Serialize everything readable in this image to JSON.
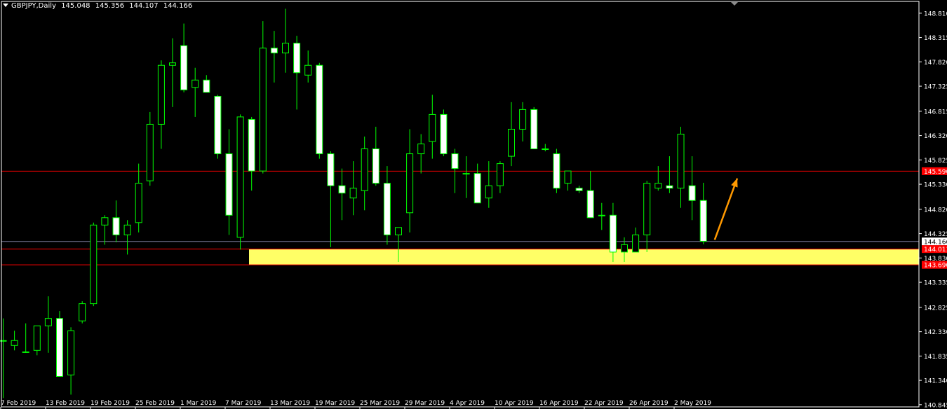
{
  "header": {
    "symbol": "GBPJPY,Daily",
    "open": "145.048",
    "high": "145.356",
    "low": "144.107",
    "close": "144.166"
  },
  "colors": {
    "background": "#000000",
    "frame": "#ffffff",
    "candle_bull_body": "#000000",
    "candle_bear_body": "#ffffff",
    "wick": "#00ff00",
    "hline": "#ff0000",
    "zone_fill": "#ffff66",
    "current_price_line": "#7f7f9f",
    "arrow": "#ff9900"
  },
  "chart_data": {
    "type": "candlestick",
    "y_ticks": [
      "148.810",
      "148.315",
      "147.820",
      "147.325",
      "146.815",
      "146.320",
      "145.825",
      "145.330",
      "144.820",
      "144.325",
      "143.830",
      "143.335",
      "142.825",
      "142.330",
      "141.835",
      "141.340",
      "140.845"
    ],
    "x_ticks": [
      "7 Feb 2019",
      "13 Feb 2019",
      "19 Feb 2019",
      "25 Feb 2019",
      "1 Mar 2019",
      "7 Mar 2019",
      "13 Mar 2019",
      "19 Mar 2019",
      "25 Mar 2019",
      "29 Mar 2019",
      "4 Apr 2019",
      "10 Apr 2019",
      "16 Apr 2019",
      "22 Apr 2019",
      "26 Apr 2019",
      "2 May 2019"
    ],
    "ylim": [
      140.8,
      149.05
    ],
    "candles": [
      {
        "o": 142.15,
        "h": 142.6,
        "l": 140.98,
        "c": 142.15
      },
      {
        "o": 142.05,
        "h": 142.35,
        "l": 141.95,
        "c": 142.15
      },
      {
        "o": 141.92,
        "h": 142.5,
        "l": 141.9,
        "c": 141.92
      },
      {
        "o": 141.95,
        "h": 142.4,
        "l": 141.85,
        "c": 142.45
      },
      {
        "o": 142.45,
        "h": 143.05,
        "l": 141.9,
        "c": 142.6
      },
      {
        "o": 142.6,
        "h": 142.75,
        "l": 141.42,
        "c": 141.42
      },
      {
        "o": 141.45,
        "h": 142.42,
        "l": 141.05,
        "c": 142.35
      },
      {
        "o": 142.55,
        "h": 142.95,
        "l": 142.5,
        "c": 142.9
      },
      {
        "o": 142.9,
        "h": 144.55,
        "l": 142.85,
        "c": 144.5
      },
      {
        "o": 144.5,
        "h": 144.7,
        "l": 144.1,
        "c": 144.65
      },
      {
        "o": 144.65,
        "h": 145.0,
        "l": 144.15,
        "c": 144.3
      },
      {
        "o": 144.3,
        "h": 144.6,
        "l": 143.9,
        "c": 144.5
      },
      {
        "o": 144.55,
        "h": 145.75,
        "l": 144.35,
        "c": 145.35
      },
      {
        "o": 145.4,
        "h": 146.8,
        "l": 145.3,
        "c": 146.55
      },
      {
        "o": 146.55,
        "h": 147.85,
        "l": 146.05,
        "c": 147.75
      },
      {
        "o": 147.75,
        "h": 148.3,
        "l": 146.9,
        "c": 147.8
      },
      {
        "o": 148.15,
        "h": 148.6,
        "l": 147.2,
        "c": 147.25
      },
      {
        "o": 147.3,
        "h": 147.7,
        "l": 146.7,
        "c": 147.45
      },
      {
        "o": 147.45,
        "h": 147.55,
        "l": 147.2,
        "c": 147.2
      },
      {
        "o": 147.12,
        "h": 147.15,
        "l": 145.85,
        "c": 145.95
      },
      {
        "o": 145.95,
        "h": 146.45,
        "l": 144.3,
        "c": 144.7
      },
      {
        "o": 144.25,
        "h": 146.75,
        "l": 144.0,
        "c": 146.7
      },
      {
        "o": 146.65,
        "h": 146.7,
        "l": 145.2,
        "c": 145.6
      },
      {
        "o": 145.6,
        "h": 148.65,
        "l": 145.55,
        "c": 148.1
      },
      {
        "o": 148.1,
        "h": 148.45,
        "l": 147.4,
        "c": 148.0
      },
      {
        "o": 148.0,
        "h": 148.9,
        "l": 147.6,
        "c": 148.2
      },
      {
        "o": 148.2,
        "h": 148.35,
        "l": 146.85,
        "c": 147.6
      },
      {
        "o": 147.55,
        "h": 148.05,
        "l": 147.4,
        "c": 147.75
      },
      {
        "o": 147.75,
        "h": 147.8,
        "l": 145.85,
        "c": 145.95
      },
      {
        "o": 145.95,
        "h": 146.0,
        "l": 144.05,
        "c": 145.3
      },
      {
        "o": 145.3,
        "h": 145.65,
        "l": 144.6,
        "c": 145.15
      },
      {
        "o": 145.05,
        "h": 145.8,
        "l": 144.7,
        "c": 145.25
      },
      {
        "o": 145.2,
        "h": 146.3,
        "l": 144.8,
        "c": 146.05
      },
      {
        "o": 146.05,
        "h": 146.5,
        "l": 145.3,
        "c": 145.35
      },
      {
        "o": 145.35,
        "h": 145.7,
        "l": 144.1,
        "c": 144.3
      },
      {
        "o": 144.3,
        "h": 144.45,
        "l": 143.75,
        "c": 144.45
      },
      {
        "o": 144.75,
        "h": 146.45,
        "l": 144.35,
        "c": 145.95
      },
      {
        "o": 145.95,
        "h": 146.35,
        "l": 145.55,
        "c": 146.15
      },
      {
        "o": 146.2,
        "h": 147.15,
        "l": 145.85,
        "c": 146.75
      },
      {
        "o": 146.75,
        "h": 146.85,
        "l": 145.9,
        "c": 145.95
      },
      {
        "o": 145.95,
        "h": 146.05,
        "l": 145.15,
        "c": 145.65
      },
      {
        "o": 145.55,
        "h": 145.9,
        "l": 145.05,
        "c": 145.55
      },
      {
        "o": 145.55,
        "h": 145.75,
        "l": 145.2,
        "c": 144.95
      },
      {
        "o": 145.05,
        "h": 145.8,
        "l": 144.85,
        "c": 145.3
      },
      {
        "o": 145.3,
        "h": 145.8,
        "l": 145.15,
        "c": 145.75
      },
      {
        "o": 145.9,
        "h": 147.0,
        "l": 145.7,
        "c": 146.45
      },
      {
        "o": 146.45,
        "h": 147.0,
        "l": 146.2,
        "c": 146.85
      },
      {
        "o": 146.85,
        "h": 146.9,
        "l": 146.05,
        "c": 146.05
      },
      {
        "o": 146.05,
        "h": 146.15,
        "l": 146.0,
        "c": 146.05
      },
      {
        "o": 145.95,
        "h": 146.05,
        "l": 145.15,
        "c": 145.25
      },
      {
        "o": 145.35,
        "h": 145.4,
        "l": 145.2,
        "c": 145.6
      },
      {
        "o": 145.25,
        "h": 145.3,
        "l": 145.15,
        "c": 145.2
      },
      {
        "o": 145.2,
        "h": 145.6,
        "l": 144.65,
        "c": 144.65
      },
      {
        "o": 144.7,
        "h": 144.95,
        "l": 144.4,
        "c": 144.7
      },
      {
        "o": 144.7,
        "h": 144.95,
        "l": 143.75,
        "c": 143.95
      },
      {
        "o": 143.95,
        "h": 144.25,
        "l": 143.75,
        "c": 144.1
      },
      {
        "o": 143.95,
        "h": 144.45,
        "l": 143.95,
        "c": 144.3
      },
      {
        "o": 144.3,
        "h": 145.4,
        "l": 143.95,
        "c": 145.35
      },
      {
        "o": 145.25,
        "h": 145.7,
        "l": 145.2,
        "c": 145.35
      },
      {
        "o": 145.3,
        "h": 145.9,
        "l": 145.15,
        "c": 145.25
      },
      {
        "o": 145.25,
        "h": 146.5,
        "l": 144.85,
        "c": 146.35
      },
      {
        "o": 145.3,
        "h": 145.9,
        "l": 144.6,
        "c": 145.0
      },
      {
        "o": 145.0,
        "h": 145.36,
        "l": 144.11,
        "c": 144.17
      }
    ],
    "hlines": [
      {
        "price": 145.596,
        "label": "145.596"
      },
      {
        "price": 144.011,
        "label": "144.011"
      },
      {
        "price": 143.69,
        "label": "143.690"
      }
    ],
    "current_price": {
      "price": 144.166,
      "label": "144.166"
    },
    "zone": {
      "from": 143.69,
      "to": 144.011
    },
    "arrow": {
      "from": {
        "candle": 63,
        "price": 144.2
      },
      "to": {
        "candle": 65,
        "price": 145.45
      }
    }
  }
}
